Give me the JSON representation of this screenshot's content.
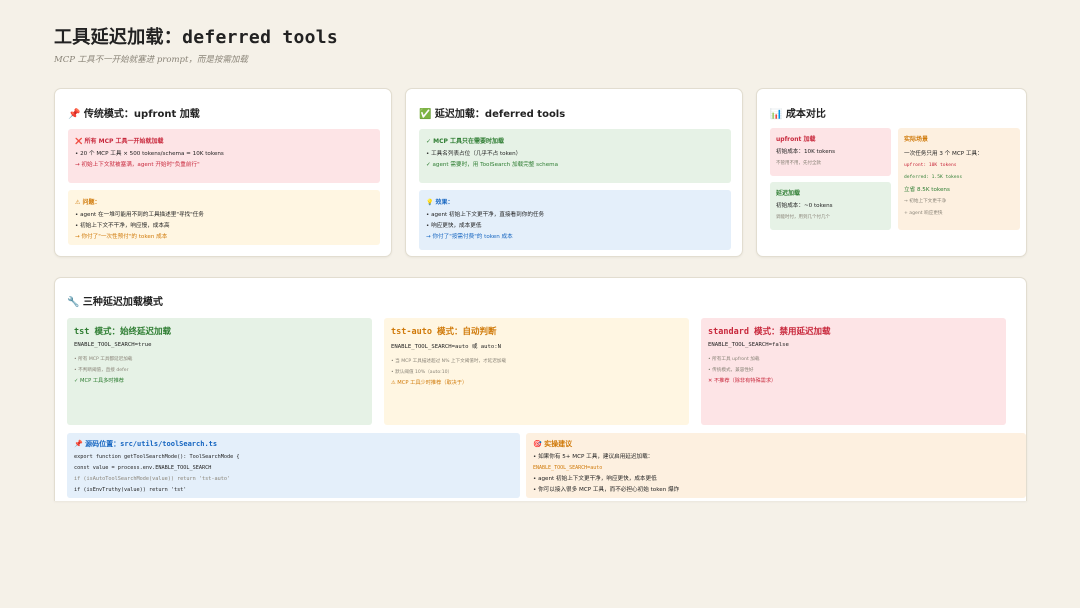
{
  "header": {
    "title_cn": "工具延迟加载：",
    "title_mono": "deferred tools",
    "subtitle": "MCP 工具不一开始就塞进 prompt，而是按需加载"
  },
  "card1": {
    "title": "📌 传统模式：upfront 加载",
    "box1": {
      "head": "❌ 所有 MCP 工具一开始就加载",
      "lines": [
        "• 20 个 MCP 工具 × 500 tokens/schema = 10K tokens",
        "→ 初始上下文就被塞满，agent 开始时\"负重前行\""
      ]
    },
    "box2": {
      "head": "⚠ 问题：",
      "lines": [
        "• agent 在一堆可能用不到的工具描述里\"寻找\"任务",
        "• 初始上下文不干净，响应慢，成本高",
        "→ 你付了\"一次性预付\"的 token 成本"
      ]
    }
  },
  "card2": {
    "title": "✅ 延迟加载：deferred tools",
    "box1": {
      "head": "✓ MCP 工具只在需要时加载",
      "lines": [
        "• 工具名列表占位（几乎不占 token）",
        "✓ agent 需要时，用 ToolSearch 加载完整 schema"
      ]
    },
    "box2": {
      "head": "💡 效果：",
      "lines": [
        "• agent 初始上下文更干净，直接看到你的任务",
        "• 响应更快，成本更低",
        "→ 你付了\"按需付费\"的 token 成本"
      ]
    }
  },
  "card3": {
    "title": "📊 成本对比",
    "upfront": {
      "head": "upfront 加载",
      "l1": "初始成本：10K tokens",
      "l2": "不管用不用，先付全款"
    },
    "deferred": {
      "head": "延迟加载",
      "l1": "初始成本：~0 tokens",
      "l2": "调能时付，用到几个付几个"
    },
    "real": {
      "head": "实际场景",
      "l1": "一次任务只用 3 个 MCP 工具：",
      "l2": "upfront: 10K tokens",
      "l3": "deferred: 1.5K tokens",
      "l4": "立省 8.5K tokens",
      "l5": "→ 初始上下文更干净",
      "l6": "+ agent 响应更快"
    }
  },
  "section": {
    "title": "🔧 三种延迟加载模式",
    "modes": [
      {
        "title": "tst 模式：始终延迟加载",
        "code": "ENABLE_TOOL_SEARCH=true",
        "l1": "• 所有 MCP 工具都延迟加载",
        "l2": "• 不判断阈值，直接 defer",
        "l3": "✓ MCP 工具多时推荐"
      },
      {
        "title": "tst-auto 模式：自动判断",
        "code": "ENABLE_TOOL_SEARCH=auto 或 auto:N",
        "l1": "• 当 MCP 工具描述超过 N% 上下文阈值时，才延迟加载",
        "l2": "• 默认阈值 10%（auto:10）",
        "l3": "⚠ MCP 工具少时推荐（取决于）"
      },
      {
        "title": "standard 模式：禁用延迟加载",
        "code": "ENABLE_TOOL_SEARCH=false",
        "l1": "• 所有工具 upfront 加载",
        "l2": "• 传统模式，兼容性好",
        "l3": "✕ 不推荐（除非有特殊需求）"
      }
    ],
    "source": {
      "head_label": "📌 源码位置：",
      "head_path": "src/utils/toolSearch.ts",
      "code": [
        "export function getToolSearchMode(): ToolSearchMode {",
        "const value = process.env.ENABLE_TOOL_SEARCH",
        "if (isAutoToolSearchMode(value)) return 'tst-auto'",
        "if (isEnvTruthy(value)) return 'tst'"
      ]
    },
    "tips": {
      "head": "🎯 实操建议",
      "l1": "• 如果你有 5+ MCP 工具，建议启用延迟加载：",
      "code": "ENABLE_TOOL_SEARCH=auto",
      "l2": "• agent 初始上下文更干净，响应更快，成本更低",
      "l3": "• 你可以接入很多 MCP 工具，而不必担心初始 token 爆炸"
    }
  }
}
